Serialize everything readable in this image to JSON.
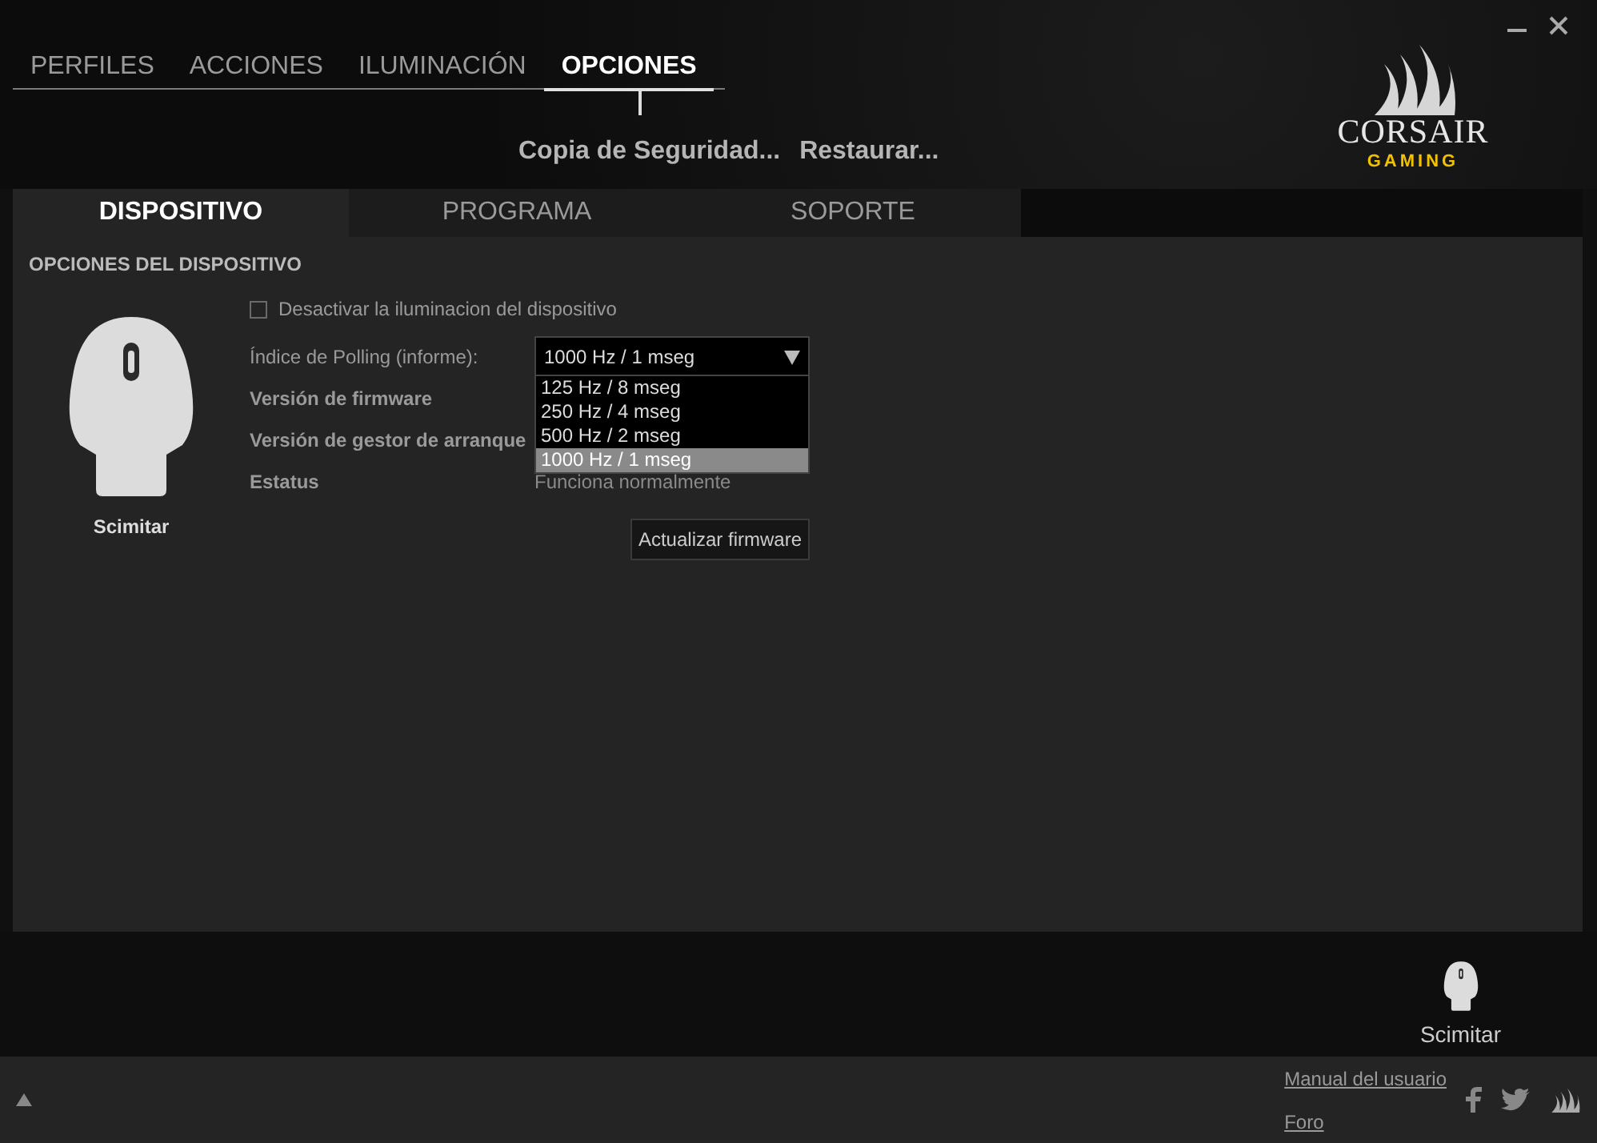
{
  "nav_tabs": [
    {
      "label": "PERFILES",
      "selected": false
    },
    {
      "label": "ACCIONES",
      "selected": false
    },
    {
      "label": "ILUMINACIÓN",
      "selected": false
    },
    {
      "label": "OPCIONES",
      "selected": true
    }
  ],
  "actions": [
    "Copia de Seguridad...",
    "Restaurar..."
  ],
  "logo": {
    "name": "CORSAIR",
    "tagline": "GAMING"
  },
  "sub_tabs": [
    {
      "label": "DISPOSITIVO",
      "selected": true
    },
    {
      "label": "PROGRAMA",
      "selected": false
    },
    {
      "label": "SOPORTE",
      "selected": false
    }
  ],
  "section_title": "OPCIONES DEL DISPOSITIVO",
  "device": {
    "name": "Scimitar"
  },
  "illumination_checkbox": {
    "label": "Desactivar la iluminacion del dispositivo",
    "checked": false
  },
  "polling": {
    "label": "Índice de Polling (informe):",
    "value": "1000 Hz / 1 mseg",
    "expanded": true,
    "options": [
      {
        "label": "125 Hz / 8 mseg",
        "selected": false
      },
      {
        "label": "250 Hz / 4 mseg",
        "selected": false
      },
      {
        "label": "500 Hz / 2 mseg",
        "selected": false
      },
      {
        "label": "1000 Hz / 1 mseg",
        "selected": true
      }
    ]
  },
  "info_rows": [
    {
      "label": "Versión de firmware"
    },
    {
      "label": "Versión de gestor de arranque"
    },
    {
      "label": "Estatus",
      "value": "Funciona normalmente"
    }
  ],
  "update_button": "Actualizar firmware",
  "bottom_device": {
    "name": "Scimitar"
  },
  "footer": {
    "links": [
      "Manual del usuario",
      "Foro"
    ]
  }
}
